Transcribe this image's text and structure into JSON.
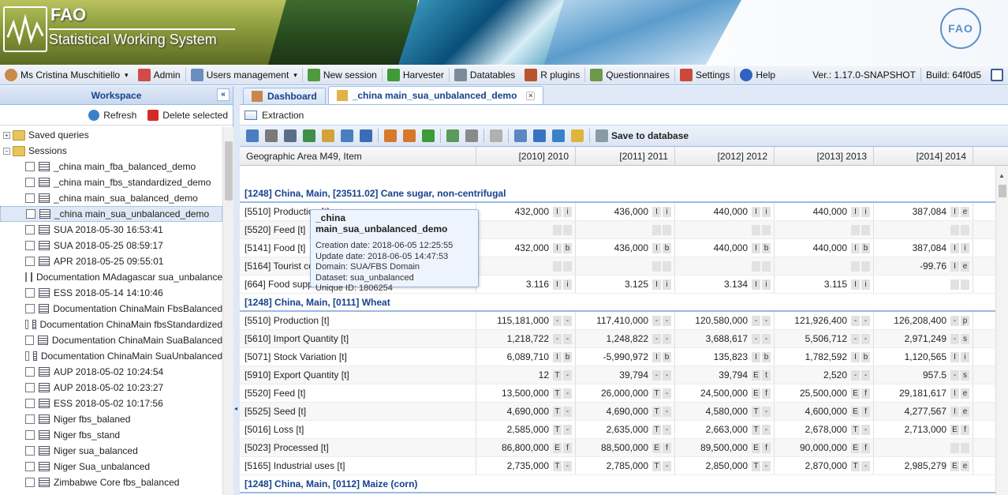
{
  "banner": {
    "org": "FAO",
    "system": "Statistical Working System",
    "emblem": "FAO"
  },
  "menubar": {
    "user": "Ms Cristina Muschitiello",
    "items": [
      "Admin",
      "Users management",
      "New session",
      "Harvester",
      "Datatables",
      "R plugins",
      "Questionnaires",
      "Settings",
      "Help"
    ],
    "version": "Ver.: 1.17.0-SNAPSHOT",
    "build": "Build: 64f0d5"
  },
  "workspace": {
    "title": "Workspace",
    "refresh": "Refresh",
    "delete": "Delete selected",
    "saved_queries": "Saved queries",
    "sessions": "Sessions",
    "items": [
      "_china main_fba_balanced_demo",
      "_china main_fbs_standardized_demo",
      "_china main_sua_balanced_demo",
      "_china main_sua_unbalanced_demo",
      "SUA 2018-05-30 16:53:41",
      "SUA 2018-05-25 08:59:17",
      "APR 2018-05-25 09:55:01",
      "Documentation MAdagascar sua_unbalanced",
      "ESS 2018-05-14 14:10:46",
      "Documentation ChinaMain FbsBalanced",
      "Documentation ChinaMain fbsStandardized",
      "Documentation ChinaMain SuaBalanced",
      "Documentation ChinaMain SuaUnbalanced",
      "AUP 2018-05-02 10:24:54",
      "AUP 2018-05-02 10:23:27",
      "ESS 2018-05-02 10:17:56",
      "Niger fbs_balaned",
      "Niger fbs_stand",
      "Niger sua_balanced",
      "Niger Sua_unbalanced",
      "Zimbabwe Core fbs_balanced"
    ]
  },
  "tabs": {
    "dashboard": "Dashboard",
    "active": "_china main_sua_unbalanced_demo"
  },
  "extraction": "Extraction",
  "toolbar": {
    "save": "Save to database"
  },
  "grid": {
    "col0": "Geographic Area M49, Item",
    "years": [
      "[2010] 2010",
      "[2011] 2011",
      "[2012] 2012",
      "[2013] 2013",
      "[2014] 2014"
    ],
    "groups": [
      {
        "title": "[1248] China, Main, [23511.02] Cane sugar, non-centrifugal",
        "rows": [
          {
            "name": "[5510] Production [t]",
            "cells": [
              [
                "432,000",
                "I",
                "i"
              ],
              [
                "436,000",
                "I",
                "i"
              ],
              [
                "440,000",
                "I",
                "i"
              ],
              [
                "440,000",
                "I",
                "i"
              ],
              [
                "387,084",
                "I",
                "e"
              ]
            ]
          },
          {
            "name": "[5520] Feed [t]",
            "cells": [
              [
                "",
                "",
                ""
              ],
              [
                "",
                "",
                ""
              ],
              [
                "",
                "",
                ""
              ],
              [
                "",
                "",
                ""
              ],
              [
                "",
                "",
                ""
              ]
            ]
          },
          {
            "name": "[5141] Food [t]",
            "cells": [
              [
                "432,000",
                "I",
                "b"
              ],
              [
                "436,000",
                "I",
                "b"
              ],
              [
                "440,000",
                "I",
                "b"
              ],
              [
                "440,000",
                "I",
                "b"
              ],
              [
                "387,084",
                "I",
                "i"
              ]
            ]
          },
          {
            "name": "[5164] Tourist co",
            "cells": [
              [
                "",
                "",
                ""
              ],
              [
                "",
                "",
                ""
              ],
              [
                "",
                "",
                ""
              ],
              [
                "",
                "",
                ""
              ],
              [
                "-99.76",
                "I",
                "e"
              ]
            ]
          },
          {
            "name": "[664] Food supp",
            "cells": [
              [
                "3.116",
                "I",
                "i"
              ],
              [
                "3.125",
                "I",
                "i"
              ],
              [
                "3.134",
                "I",
                "i"
              ],
              [
                "3.115",
                "I",
                "i"
              ],
              [
                "",
                "",
                ""
              ]
            ]
          }
        ]
      },
      {
        "title": "[1248] China, Main, [0111] Wheat",
        "rows": [
          {
            "name": "[5510] Production [t]",
            "cells": [
              [
                "115,181,000",
                "",
                ""
              ],
              [
                "117,410,000",
                "",
                ""
              ],
              [
                "120,580,000",
                "",
                ""
              ],
              [
                "121,926,400",
                "",
                ""
              ],
              [
                "126,208,400",
                "",
                "p"
              ]
            ]
          },
          {
            "name": "[5610] Import Quantity [t]",
            "cells": [
              [
                "1,218,722",
                "",
                ""
              ],
              [
                "1,248,822",
                "",
                ""
              ],
              [
                "3,688,617",
                "",
                ""
              ],
              [
                "5,506,712",
                "",
                ""
              ],
              [
                "2,971,249",
                "",
                "s"
              ]
            ]
          },
          {
            "name": "[5071] Stock Variation [t]",
            "cells": [
              [
                "6,089,710",
                "I",
                "b"
              ],
              [
                "-5,990,972",
                "I",
                "b"
              ],
              [
                "135,823",
                "I",
                "b"
              ],
              [
                "1,782,592",
                "I",
                "b"
              ],
              [
                "1,120,565",
                "I",
                "i"
              ]
            ]
          },
          {
            "name": "[5910] Export Quantity [t]",
            "cells": [
              [
                "12",
                "T",
                ""
              ],
              [
                "39,794",
                "",
                ""
              ],
              [
                "39,794",
                "E",
                "t"
              ],
              [
                "2,520",
                "",
                ""
              ],
              [
                "957.5",
                "",
                "s"
              ]
            ]
          },
          {
            "name": "[5520] Feed [t]",
            "cells": [
              [
                "13,500,000",
                "T",
                ""
              ],
              [
                "26,000,000",
                "T",
                ""
              ],
              [
                "24,500,000",
                "E",
                "f"
              ],
              [
                "25,500,000",
                "E",
                "f"
              ],
              [
                "29,181,617",
                "I",
                "e"
              ]
            ]
          },
          {
            "name": "[5525] Seed [t]",
            "cells": [
              [
                "4,690,000",
                "T",
                ""
              ],
              [
                "4,690,000",
                "T",
                ""
              ],
              [
                "4,580,000",
                "T",
                ""
              ],
              [
                "4,600,000",
                "E",
                "f"
              ],
              [
                "4,277,567",
                "I",
                "e"
              ]
            ]
          },
          {
            "name": "[5016] Loss [t]",
            "cells": [
              [
                "2,585,000",
                "T",
                ""
              ],
              [
                "2,635,000",
                "T",
                ""
              ],
              [
                "2,663,000",
                "T",
                ""
              ],
              [
                "2,678,000",
                "T",
                ""
              ],
              [
                "2,713,000",
                "E",
                "f"
              ]
            ]
          },
          {
            "name": "[5023] Processed [t]",
            "cells": [
              [
                "86,800,000",
                "E",
                "f"
              ],
              [
                "88,500,000",
                "E",
                "f"
              ],
              [
                "89,500,000",
                "E",
                "f"
              ],
              [
                "90,000,000",
                "E",
                "f"
              ],
              [
                "",
                "",
                ""
              ]
            ]
          },
          {
            "name": "[5165] Industrial uses [t]",
            "cells": [
              [
                "2,735,000",
                "T",
                ""
              ],
              [
                "2,785,000",
                "T",
                ""
              ],
              [
                "2,850,000",
                "T",
                ""
              ],
              [
                "2,870,000",
                "T",
                ""
              ],
              [
                "2,985,279",
                "E",
                "e"
              ]
            ]
          }
        ]
      },
      {
        "title": "[1248] China, Main, [0112] Maize (corn)",
        "rows": []
      }
    ]
  },
  "tooltip": {
    "title": "_china main_sua_unbalanced_demo",
    "lines": [
      "Creation date: 2018-06-05 12:25:55",
      "Update date: 2018-06-05 14:47:53",
      "Domain: SUA/FBS Domain",
      "Dataset: sua_unbalanced",
      "Unique ID: 1806254"
    ]
  }
}
